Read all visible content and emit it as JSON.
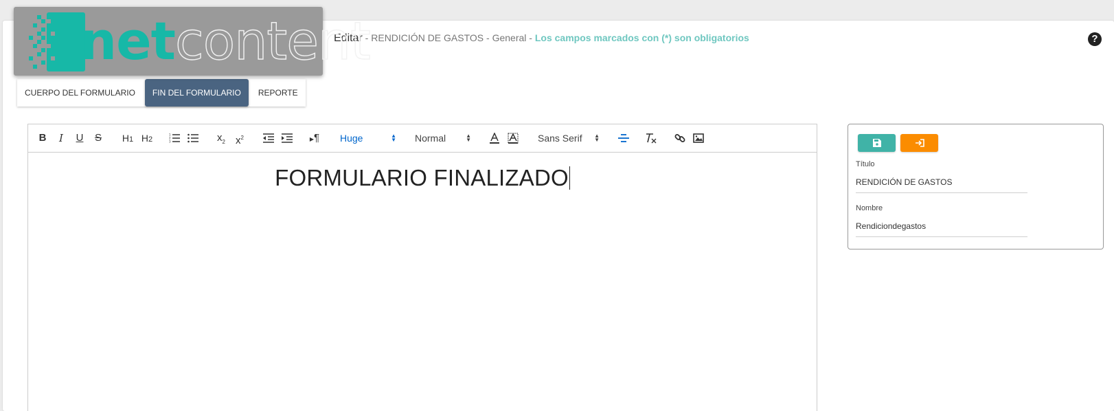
{
  "logo": {
    "part1": "net",
    "part2": "content"
  },
  "header": {
    "edit_label": "Editar",
    "separator": " - ",
    "form_name": "RENDICIÓN DE GASTOS",
    "category": "General",
    "required_note": "Los campos marcados con (*) son obligatorios",
    "help_symbol": "?"
  },
  "tabs": [
    {
      "label": "CUERPO DEL FORMULARIO",
      "active": false
    },
    {
      "label": "FIN DEL FORMULARIO",
      "active": true
    },
    {
      "label": "REPORTE",
      "active": false
    }
  ],
  "toolbar": {
    "bold": "B",
    "italic": "I",
    "underline": "U",
    "strike": "S",
    "h1": "H",
    "h1_sub": "1",
    "h2": "H",
    "h2_sub": "2",
    "subscript": "x",
    "subscript_mark": "2",
    "superscript": "x",
    "superscript_mark": "2",
    "direction": "¶",
    "size_picker": "Huge",
    "header_picker": "Normal",
    "font_picker": "Sans Serif"
  },
  "editor": {
    "content": "FORMULARIO FINALIZADO"
  },
  "panel": {
    "title_label": "Título",
    "title_value": "RENDICIÓN DE GASTOS",
    "name_label": "Nombre",
    "name_value": "Rendiciondegastos"
  },
  "colors": {
    "accent_teal": "#40b3a7",
    "accent_orange": "#fb8c00",
    "tab_active": "#4a6481",
    "required_note": "#6fc7c0",
    "quill_blue": "#0066cc"
  },
  "icons": [
    "help-icon",
    "ordered-list-icon",
    "bullet-list-icon",
    "outdent-icon",
    "indent-icon",
    "text-color-icon",
    "background-color-icon",
    "align-center-icon",
    "clear-format-icon",
    "link-icon",
    "image-icon",
    "save-icon",
    "exit-icon"
  ]
}
